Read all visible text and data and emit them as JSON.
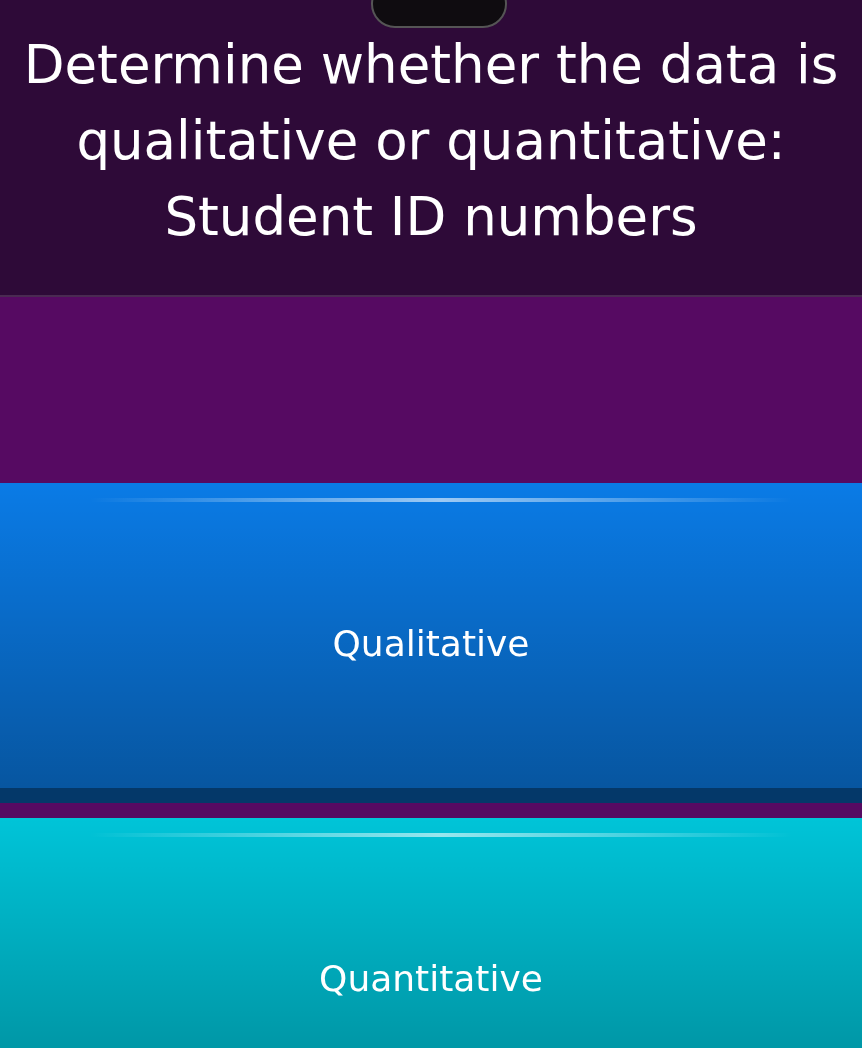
{
  "question": {
    "text": "Determine whether the data is qualitative or quantitative: Student ID numbers"
  },
  "answers": [
    {
      "label": "Qualitative",
      "color": "#0a7be6"
    },
    {
      "label": "Quantitative",
      "color": "#00c4d8"
    }
  ]
}
